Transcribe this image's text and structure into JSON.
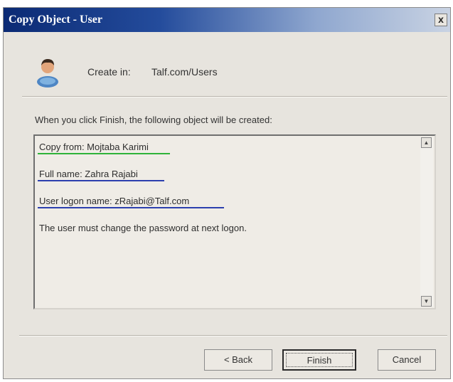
{
  "window": {
    "title": "Copy Object - User",
    "close_glyph": "x"
  },
  "header": {
    "icon": "user-icon",
    "create_in_label": "Create in:",
    "create_in_value": "Talf.com/Users"
  },
  "info_text": "When you click Finish, the following object will be created:",
  "summary": {
    "lines": [
      "Copy from: Mojtaba Karimi",
      "Full name: Zahra Rajabi",
      "User logon name: zRajabi@Talf.com",
      "The user must change the password at next logon."
    ],
    "highlight_colors": [
      "#2fb33a",
      "#2c3fae",
      "#2c3fae"
    ]
  },
  "scrollbar": {
    "up_glyph": "▲",
    "down_glyph": "▼"
  },
  "buttons": {
    "back": "< Back",
    "finish": "Finish",
    "cancel": "Cancel"
  }
}
